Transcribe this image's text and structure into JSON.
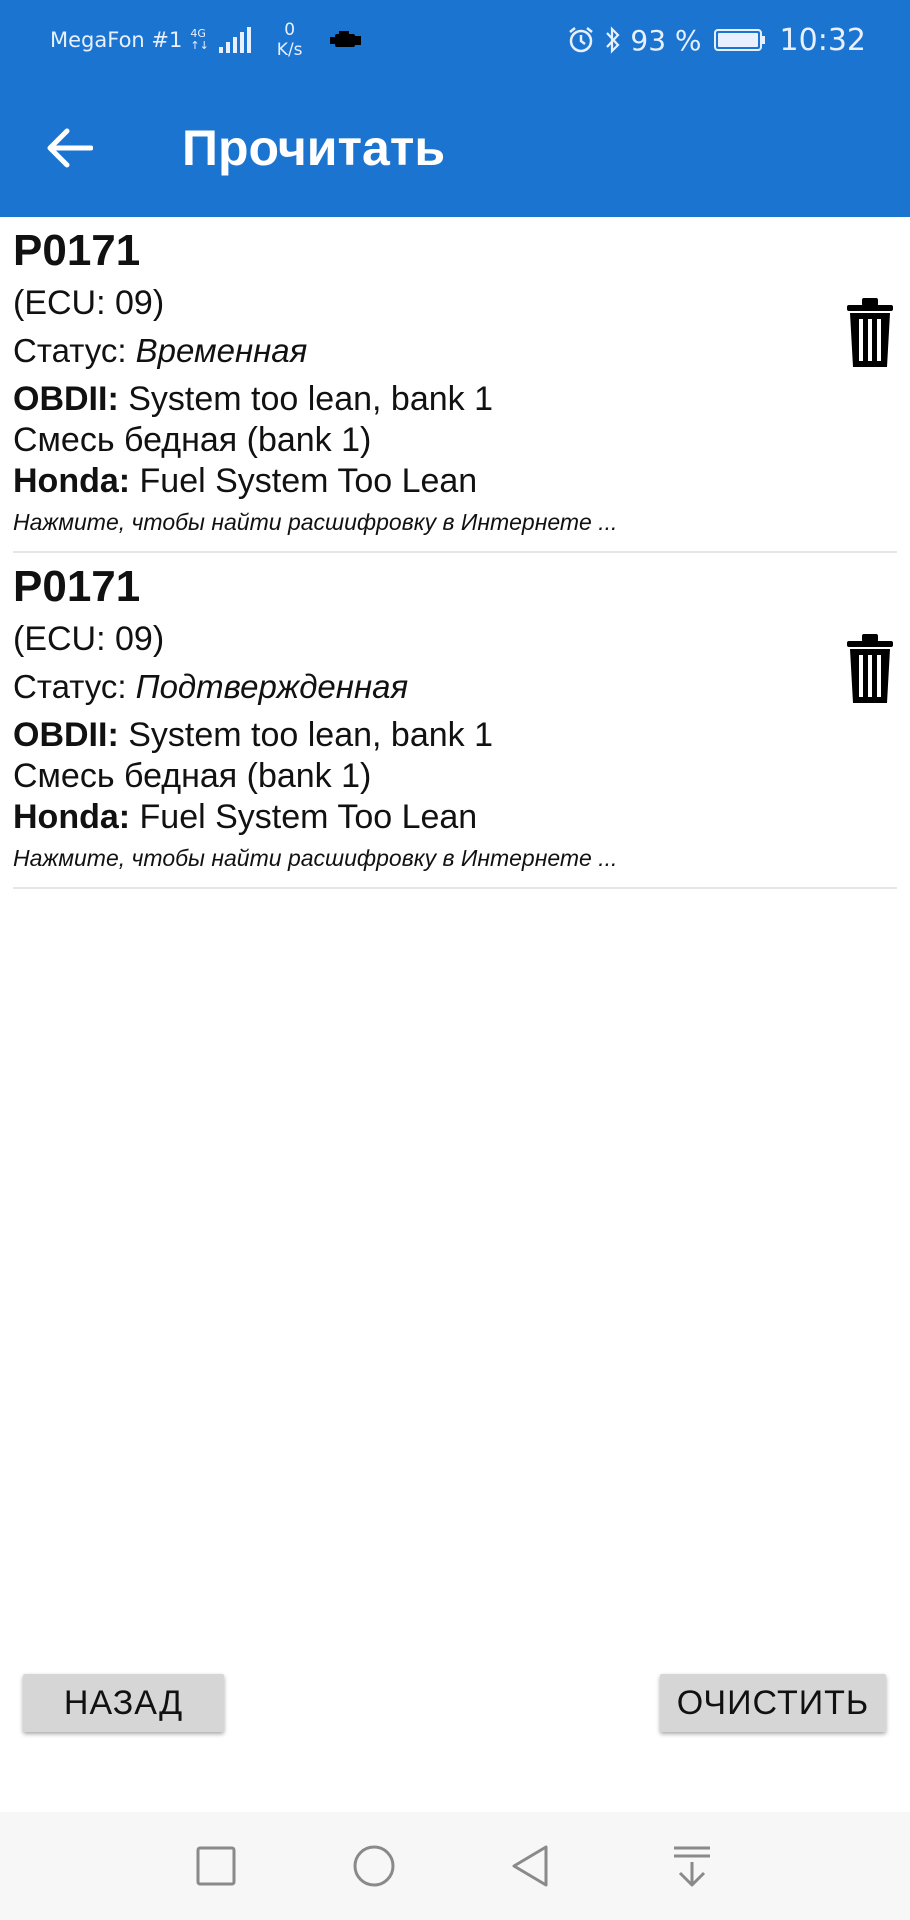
{
  "status_bar": {
    "carrier": "MegaFon #1",
    "network_type": "4G",
    "network_sub": "↑↓",
    "speed_value": "0",
    "speed_unit": "K/s",
    "battery_percent": "93 %",
    "time": "10:32"
  },
  "app_bar": {
    "title": "Прочитать",
    "back_icon": "arrow-back-icon"
  },
  "dtc_list": [
    {
      "code": "P0171",
      "ecu": "(ECU: 09)",
      "status_label": "Статус: ",
      "status_value": "Временная",
      "obd_label": "OBDII:",
      "obd_desc": " System too lean, bank 1",
      "obd_desc_ru": "Смесь бедная (bank 1)",
      "mfr_label": "Honda:",
      "mfr_desc": " Fuel System Too Lean",
      "hint": "Нажмите, чтобы найти расшифровку в Интернете ..."
    },
    {
      "code": "P0171",
      "ecu": "(ECU: 09)",
      "status_label": "Статус: ",
      "status_value": "Подтвержденная",
      "obd_label": "OBDII:",
      "obd_desc": " System too lean, bank 1",
      "obd_desc_ru": "Смесь бедная (bank 1)",
      "mfr_label": "Honda:",
      "mfr_desc": " Fuel System Too Lean",
      "hint": "Нажмите, чтобы найти расшифровку в Интернете ..."
    }
  ],
  "buttons": {
    "back_label": "НАЗАД",
    "clear_label": "ОЧИСТИТЬ"
  },
  "nav_bar": {
    "icons": [
      "square-recents-icon",
      "circle-home-icon",
      "triangle-back-icon",
      "notification-pull-icon"
    ]
  },
  "colors": {
    "primary": "#1b75d0",
    "button_bg": "#d6d6d6",
    "divider": "#e6e6e6"
  }
}
